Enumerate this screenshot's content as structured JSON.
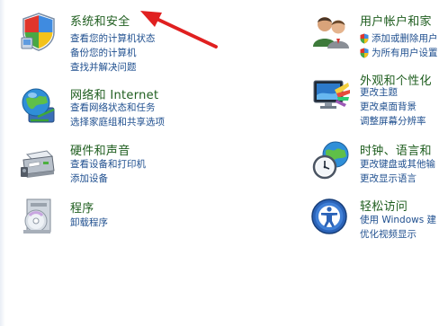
{
  "categories": {
    "system": {
      "title": "系统和安全",
      "links": [
        "查看您的计算机状态",
        "备份您的计算机",
        "查找并解决问题"
      ],
      "icon": "shield-system-icon"
    },
    "network": {
      "title": "网络和 Internet",
      "links": [
        "查看网络状态和任务",
        "选择家庭组和共享选项"
      ],
      "icon": "network-globe-icon"
    },
    "hardware": {
      "title": "硬件和声音",
      "links": [
        "查看设备和打印机",
        "添加设备"
      ],
      "icon": "printer-icon"
    },
    "programs": {
      "title": "程序",
      "links": [
        "卸载程序"
      ],
      "icon": "programs-disc-icon"
    },
    "users": {
      "title": "用户帐户和家",
      "links": [
        "添加或删除用户",
        "为所有用户设置"
      ],
      "icon": "users-icon"
    },
    "appearance": {
      "title": "外观和个性化",
      "links": [
        "更改主题",
        "更改桌面背景",
        "调整屏幕分辨率"
      ],
      "icon": "monitor-palette-icon"
    },
    "clock": {
      "title": "时钟、语言和",
      "links": [
        "更改键盘或其他输",
        "更改显示语言"
      ],
      "icon": "clock-globe-icon"
    },
    "ease": {
      "title": "轻松访问",
      "links": [
        "使用 Windows 建",
        "优化视频显示"
      ],
      "icon": "ease-of-access-icon"
    }
  },
  "colors": {
    "title_green": "#1e5d1e",
    "link_blue": "#1f4f8f",
    "arrow_red": "#e02020"
  }
}
